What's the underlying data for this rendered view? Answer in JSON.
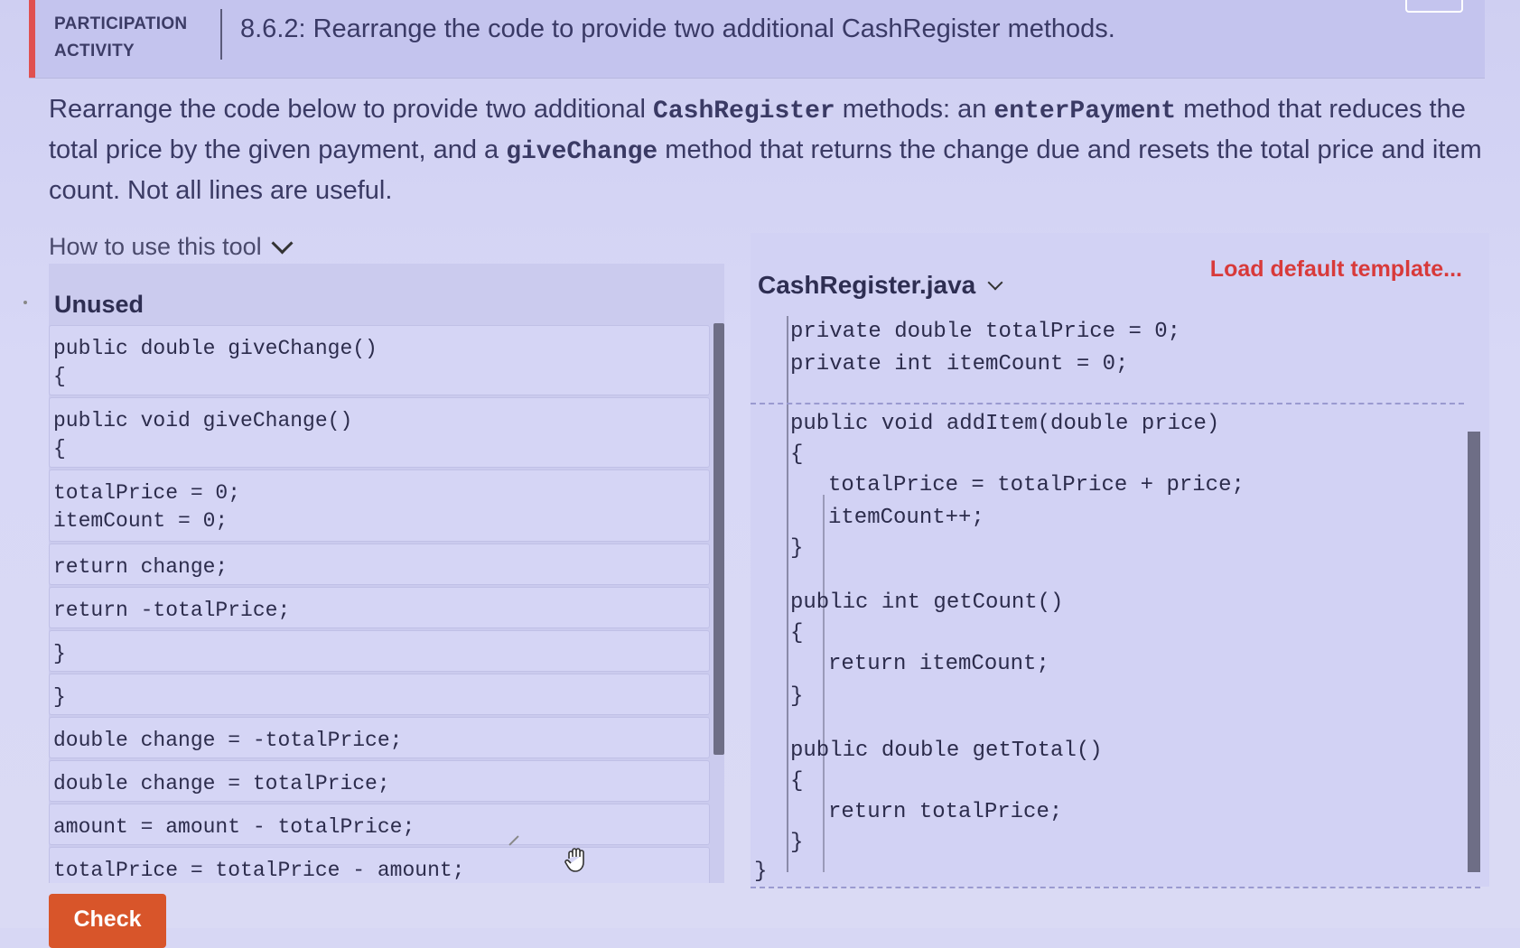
{
  "header": {
    "activity_type_line1": "PARTICIPATION",
    "activity_type_line2": "ACTIVITY",
    "title": "8.6.2: Rearrange the code to provide two additional CashRegister methods."
  },
  "instructions": {
    "part1": "Rearrange the code below to provide two additional ",
    "code1": "CashRegister",
    "part2": " methods: an ",
    "code2": "enterPayment",
    "part3": " method that reduces the total price by the given payment, and a ",
    "code3": "giveChange",
    "part4": " method that returns the change due and resets the total price and item count. Not all lines are useful."
  },
  "how_to": {
    "label": "How to use this tool"
  },
  "unused": {
    "title": "Unused",
    "blocks": [
      "public double giveChange()\n{",
      "public void giveChange()\n{",
      "totalPrice = 0;\nitemCount = 0;",
      "return change;",
      "return -totalPrice;",
      "}",
      "}",
      "double change = -totalPrice;",
      "double change = totalPrice;",
      "amount = amount - totalPrice;",
      "totalPrice = totalPrice - amount;"
    ]
  },
  "editor": {
    "file_name": "CashRegister.java",
    "load_default": "Load default template...",
    "lines": [
      "private double totalPrice = 0;",
      "private int itemCount = 0;",
      "public void addItem(double price)",
      "{",
      "totalPrice = totalPrice + price;",
      "itemCount++;",
      "}",
      "public int getCount()",
      "{",
      "return itemCount;",
      "}",
      "public double getTotal()",
      "{",
      "return totalPrice;",
      "}",
      "}"
    ]
  },
  "check_button": {
    "label": "Check"
  },
  "colors": {
    "accent_red": "#e05050",
    "load_default": "#d83a3a",
    "check_button": "#d8552a"
  }
}
